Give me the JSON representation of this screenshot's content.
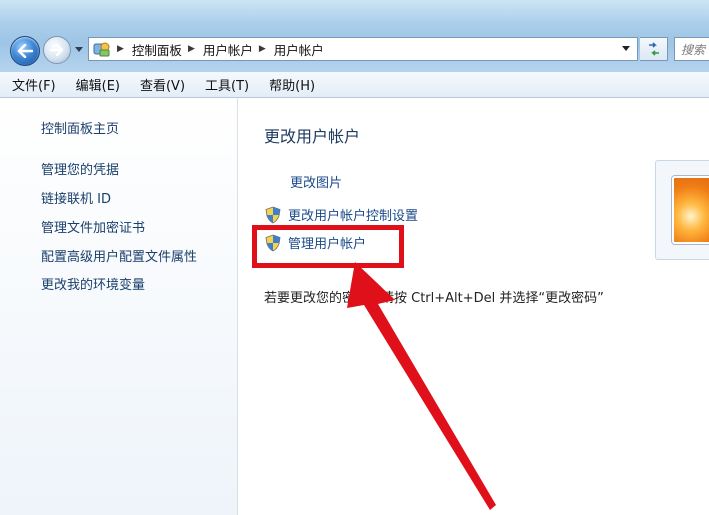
{
  "window": {
    "breadcrumb": [
      "控制面板",
      "用户帐户",
      "用户帐户"
    ],
    "search_placeholder": "搜索"
  },
  "menubar": {
    "items": [
      "文件(F)",
      "编辑(E)",
      "查看(V)",
      "工具(T)",
      "帮助(H)"
    ]
  },
  "left_pane": {
    "home_link": "控制面板主页",
    "links": [
      "管理您的凭据",
      "链接联机 ID",
      "管理文件加密证书",
      "配置高级用户配置文件属性",
      "更改我的环境变量"
    ]
  },
  "main": {
    "heading": "更改用户帐户",
    "change_picture": "更改图片",
    "uac_settings": "更改用户帐户控制设置",
    "manage_accounts": "管理用户帐户",
    "password_hint": "若要更改您的密码，请按 Ctrl+Alt+Del 并选择“更改密码”"
  },
  "colors": {
    "annotation": "#e0101a",
    "link": "#1a4a8a",
    "chrome": "#a9cdea"
  },
  "icons": [
    "back-arrow-icon",
    "forward-arrow-icon",
    "control-panel-icon",
    "chevron-down-icon",
    "refresh-icon",
    "shield-icon",
    "user-picture-icon"
  ]
}
